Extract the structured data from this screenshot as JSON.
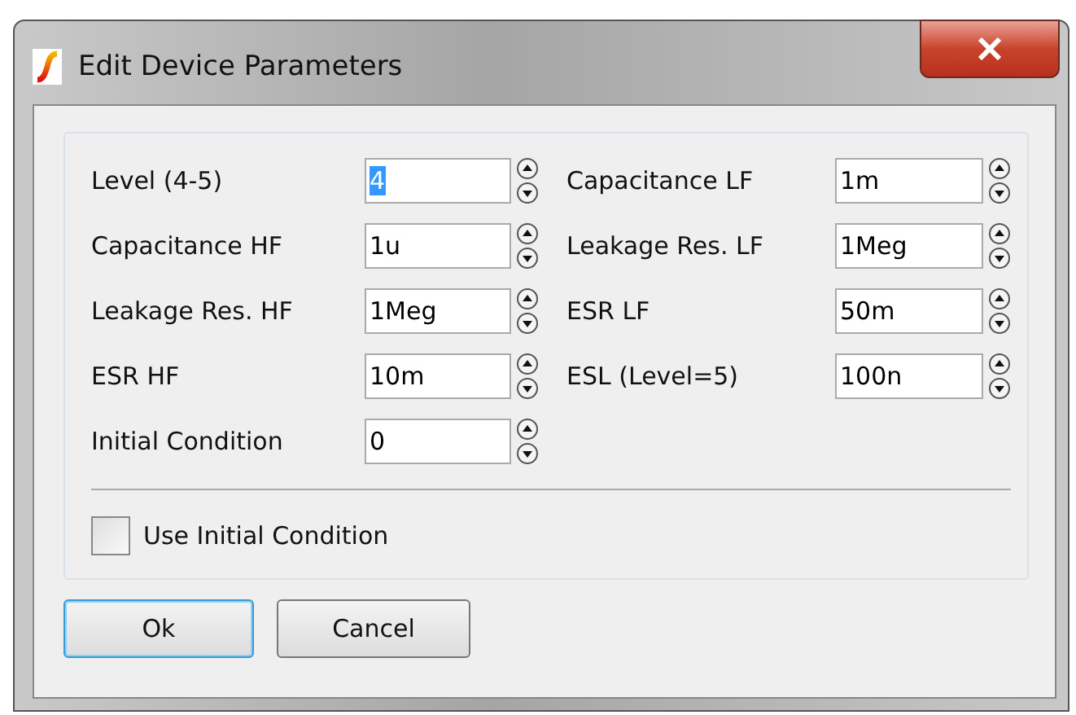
{
  "window": {
    "title": "Edit Device Parameters"
  },
  "rows": [
    {
      "left": {
        "label": "Level (4-5)",
        "value": "4",
        "selected": true
      },
      "right": {
        "label": "Capacitance LF",
        "value": "1m",
        "selected": false
      }
    },
    {
      "left": {
        "label": "Capacitance HF",
        "value": "1u",
        "selected": false
      },
      "right": {
        "label": "Leakage Res. LF",
        "value": "1Meg",
        "selected": false
      }
    },
    {
      "left": {
        "label": "Leakage Res. HF",
        "value": "1Meg",
        "selected": false
      },
      "right": {
        "label": "ESR LF",
        "value": "50m",
        "selected": false
      }
    },
    {
      "left": {
        "label": "ESR HF",
        "value": "10m",
        "selected": false
      },
      "right": {
        "label": "ESL (Level=5)",
        "value": "100n",
        "selected": false
      }
    },
    {
      "left": {
        "label": "Initial Condition",
        "value": "0",
        "selected": false
      }
    }
  ],
  "checkbox": {
    "label": "Use Initial Condition",
    "checked": false
  },
  "buttons": [
    {
      "label": "Ok",
      "default": true
    },
    {
      "label": "Cancel",
      "default": false
    }
  ]
}
